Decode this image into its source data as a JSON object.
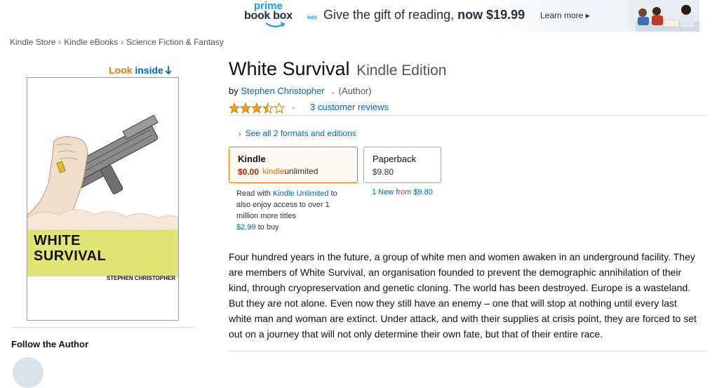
{
  "banner": {
    "brand_prime": "prime",
    "brand_bookbox": "book box",
    "brand_kids": "kids",
    "offer_text": "Give the gift of reading,",
    "offer_price": "now $19.99",
    "learn_more": "Learn more ▸"
  },
  "breadcrumb": [
    "Kindle Store",
    "Kindle eBooks",
    "Science Fiction & Fantasy"
  ],
  "look_inside": {
    "look": "Look",
    "inside": "inside"
  },
  "cover": {
    "title_line1": "WHITE",
    "title_line2": "SURVIVAL",
    "author": "STEPHEN CHRISTOPHER",
    "band_color": "#e0e676"
  },
  "product": {
    "title": "White Survival",
    "edition": "Kindle Edition",
    "by": "by",
    "author": "Stephen Christopher",
    "author_role": "(Author)",
    "rating": 3.5,
    "rating_max": 5,
    "reviews": "3 customer reviews",
    "formats_link": "See all 2 formats and editions"
  },
  "formats": {
    "kindle": {
      "name": "Kindle",
      "price": "$0.00",
      "ku_kindle": "kindle",
      "ku_unlimited": "unlimited"
    },
    "paperback": {
      "name": "Paperback",
      "price": "$9.80"
    }
  },
  "ku_note": {
    "pre": "Read with",
    "link": "Kindle Unlimited",
    "post": "to also enjoy access to over 1 million more titles",
    "buy_price": "$2.99",
    "buy_suffix": "to buy"
  },
  "new_from": {
    "link": "1 New",
    "from": "from",
    "price": "$9.80"
  },
  "description": "Four hundred years in the future, a group of white men and women awaken in an underground facility. They are members of White Survival, an organisation founded to prevent the demographic annihilation of their kind, through cryopreservation and genetic cloning. The world has been destroyed. Europe is a wasteland. But they are not alone. Even now they still have an enemy – one that will stop at nothing until every last white man and woman are extinct. Under attack, and with their supplies at crisis point, they are forced to set out on a journey that will not only determine their own fate, but that of their entire race.",
  "follow_author": "Follow the Author",
  "colors": {
    "link": "#0066c0",
    "price": "#b12704",
    "accent": "#e77600",
    "star": "#f0a020"
  }
}
